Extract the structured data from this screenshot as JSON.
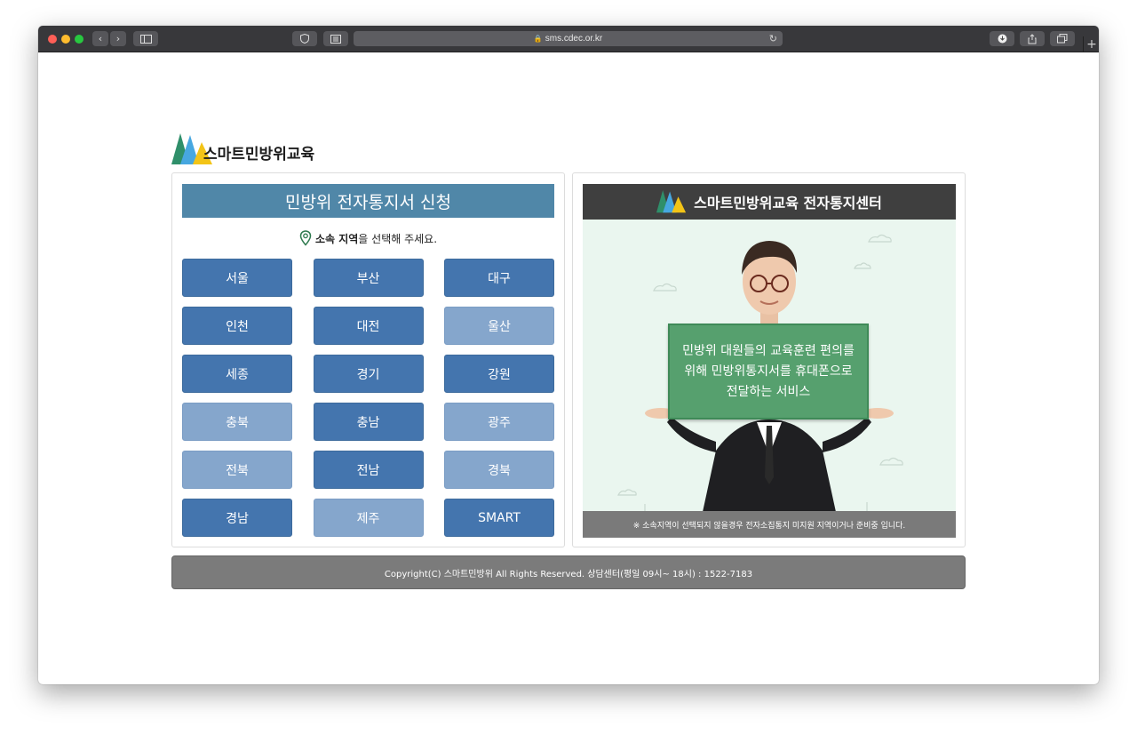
{
  "browser": {
    "url": "sms.cdec.or.kr",
    "colors": {
      "close": "#ff5f57",
      "minimize": "#febc2e",
      "maximize": "#28c840"
    }
  },
  "site": {
    "logo_text": "스마트민방위교육"
  },
  "left_panel": {
    "title": "민방위 전자통지서 신청",
    "hint_bold": "소속 지역",
    "hint_rest": "을 선택해 주세요.",
    "regions": [
      {
        "label": "서울",
        "style": "dark"
      },
      {
        "label": "부산",
        "style": "dark"
      },
      {
        "label": "대구",
        "style": "dark"
      },
      {
        "label": "인천",
        "style": "dark"
      },
      {
        "label": "대전",
        "style": "dark"
      },
      {
        "label": "울산",
        "style": "light"
      },
      {
        "label": "세종",
        "style": "dark"
      },
      {
        "label": "경기",
        "style": "dark"
      },
      {
        "label": "강원",
        "style": "dark"
      },
      {
        "label": "충북",
        "style": "light"
      },
      {
        "label": "충남",
        "style": "dark"
      },
      {
        "label": "광주",
        "style": "light"
      },
      {
        "label": "전북",
        "style": "light"
      },
      {
        "label": "전남",
        "style": "dark"
      },
      {
        "label": "경북",
        "style": "light"
      },
      {
        "label": "경남",
        "style": "dark"
      },
      {
        "label": "제주",
        "style": "light"
      },
      {
        "label": "SMART",
        "style": "dark"
      }
    ]
  },
  "right_panel": {
    "title": "스마트민방위교육 전자통지센터",
    "board_lines": [
      "민방위 대원들의 교육훈련 편의를",
      "위해 민방위통지서를 휴대폰으로",
      "전달하는 서비스"
    ],
    "notice": "※ 소속지역이 선택되지 않을경우 전자소집통지 미지원 지역이거나 준비중 입니다."
  },
  "footer": {
    "text": "Copyright(C) 스마트민방위 All Rights Reserved. 상담센터(평일 09시~ 18시) : 1522-7183"
  }
}
